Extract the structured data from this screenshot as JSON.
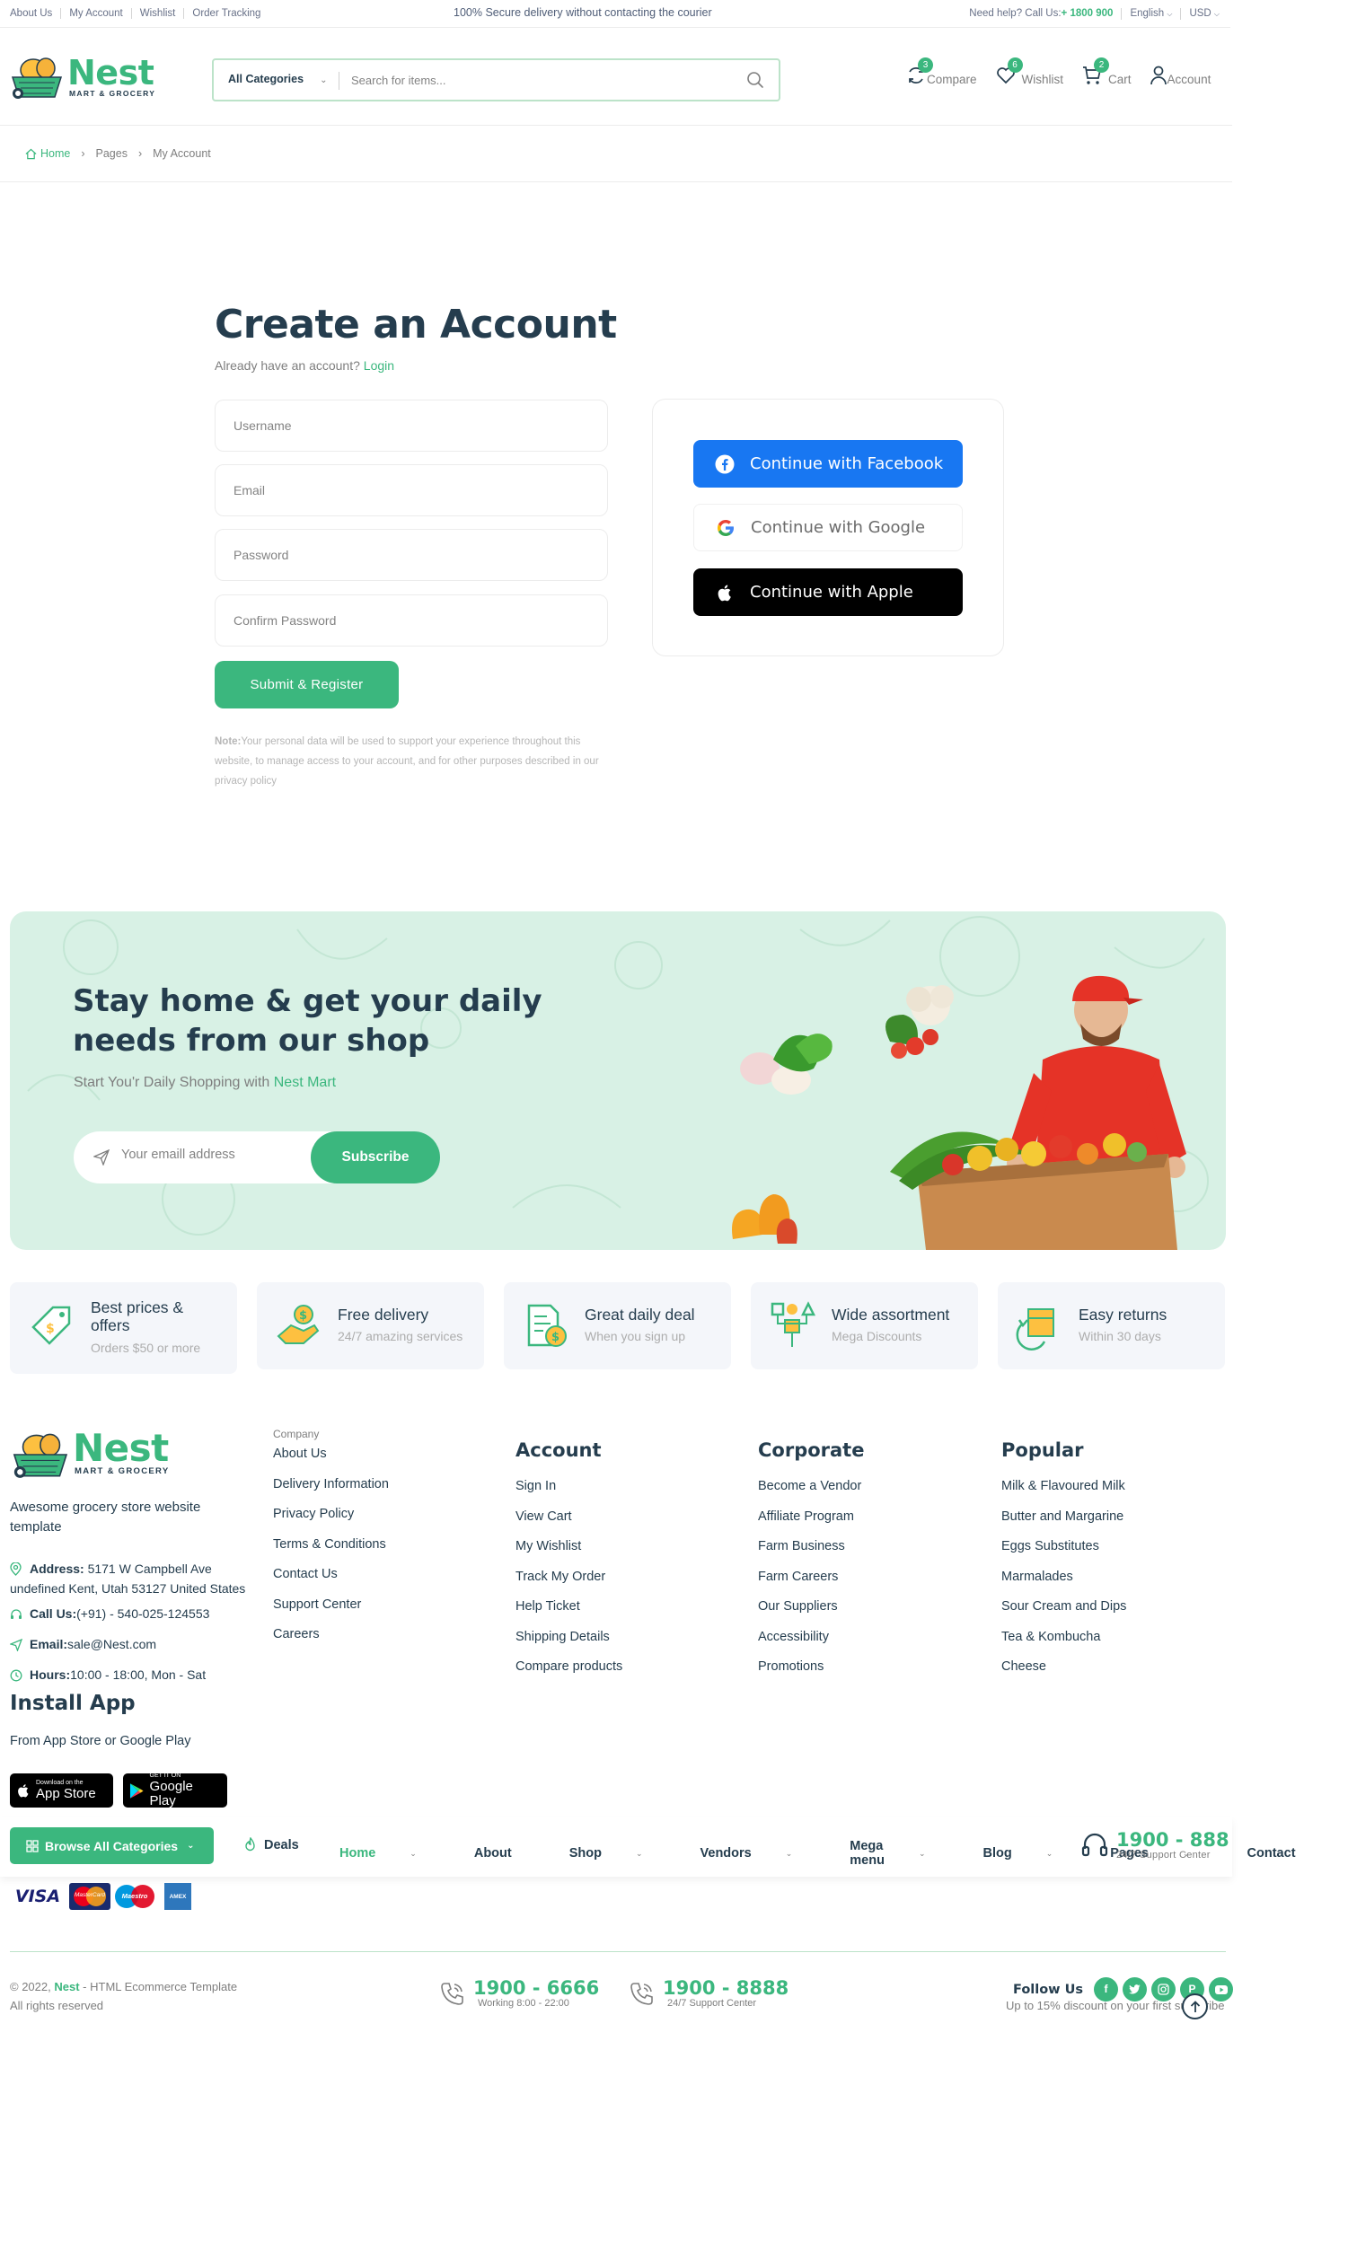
{
  "topbar": {
    "links": [
      "About Us",
      "My Account",
      "Wishlist",
      "Order Tracking"
    ],
    "notice": "100% Secure delivery without contacting the courier",
    "help_prefix": "Need help? Call Us:",
    "help_phone": "+ 1800 900",
    "language": "English",
    "currency": "USD"
  },
  "header": {
    "logo_name": "Nest",
    "logo_tagline": "MART & GROCERY",
    "search_category": "All Categories",
    "search_placeholder": "Search for items...",
    "icons": [
      {
        "label": "Compare",
        "count": "3"
      },
      {
        "label": "Wishlist",
        "count": "6"
      },
      {
        "label": "Cart",
        "count": "2"
      },
      {
        "label": "Account"
      }
    ]
  },
  "breadcrumb": [
    "Home",
    "Pages",
    "My Account"
  ],
  "register": {
    "title": "Create an Account",
    "have_account": "Already have an account?",
    "login_link": "Login",
    "placeholders": {
      "username": "Username",
      "email": "Email",
      "password": "Password",
      "confirm": "Confirm Password"
    },
    "submit": "Submit & Register",
    "note_label": "Note:",
    "note_text": "Your personal data will be used to support your experience throughout this website, to manage access to your account, and for other purposes described in our privacy policy",
    "social": {
      "facebook": "Continue with Facebook",
      "google": "Continue with Google",
      "apple": "Continue with Apple"
    }
  },
  "banner": {
    "title_line1": "Stay home & get your daily",
    "title_line2": "needs from our shop",
    "sub_prefix": "Start You'r Daily Shopping with",
    "sub_brand": "Nest Mart",
    "email_placeholder": "Your emaill address",
    "subscribe": "Subscribe"
  },
  "features": [
    {
      "title_line1": "Best prices &",
      "title_line2": "offers",
      "sub": "Orders $50 or more"
    },
    {
      "title": "Free delivery",
      "sub": "24/7 amazing services"
    },
    {
      "title": "Great daily deal",
      "sub": "When you sign up"
    },
    {
      "title": "Wide assortment",
      "sub": "Mega Discounts"
    },
    {
      "title": "Easy returns",
      "sub": "Within 30 days"
    }
  ],
  "footer": {
    "about": "Awesome grocery store website template",
    "address_label": "Address:",
    "address": "5171 W Campbell Ave undefined Kent, Utah 53127 United States",
    "call_label": "Call Us:",
    "call": "(+91) - 540-025-124553",
    "email_label": "Email:",
    "email": "sale@Nest.com",
    "hours_label": "Hours:",
    "hours": "10:00 - 18:00, Mon - Sat",
    "install_title": "Install App",
    "install_sub": "From App Store or Google Play",
    "appstore_small": "Download on the",
    "appstore_big": "App Store",
    "googleplay_small": "GET IT ON",
    "googleplay_big": "Google Play",
    "company": {
      "title": "Company",
      "items": [
        "About Us",
        "Delivery Information",
        "Privacy Policy",
        "Terms & Conditions",
        "Contact Us",
        "Support Center",
        "Careers"
      ]
    },
    "account": {
      "title": "Account",
      "items": [
        "Sign In",
        "View Cart",
        "My Wishlist",
        "Track My Order",
        "Help Ticket",
        "Shipping Details",
        "Compare products"
      ]
    },
    "corporate": {
      "title": "Corporate",
      "items": [
        "Become a Vendor",
        "Affiliate Program",
        "Farm Business",
        "Farm Careers",
        "Our Suppliers",
        "Accessibility",
        "Promotions"
      ]
    },
    "popular": {
      "title": "Popular",
      "items": [
        "Milk & Flavoured Milk",
        "Butter and Margarine",
        "Eggs Substitutes",
        "Marmalades",
        "Sour Cream and Dips",
        "Tea & Kombucha",
        "Cheese"
      ]
    }
  },
  "navbar": {
    "browse": "Browse All Categories",
    "deals": "Deals",
    "items": [
      {
        "label": "Home",
        "chev": true,
        "active": true
      },
      {
        "label": "About",
        "chev": false
      },
      {
        "label": "Shop",
        "chev": true
      },
      {
        "label": "Vendors",
        "chev": true
      },
      {
        "label": "Mega menu",
        "chev": true
      },
      {
        "label": "Blog",
        "chev": true
      },
      {
        "label": "Pages",
        "chev": true
      },
      {
        "label": "Contact",
        "chev": false
      }
    ],
    "phone": "1900 - 888",
    "phone_sub": "24/7 Support Center"
  },
  "payments": [
    "VISA",
    "MasterCard",
    "Maestro",
    "AMEX"
  ],
  "bottom": {
    "copyright_prefix": "© 2022,",
    "copyright_brand": "Nest",
    "copyright_suffix": "- HTML Ecommerce Template",
    "rights": "All rights reserved",
    "phone1": "1900 - 6666",
    "phone1_sub": "Working 8:00 - 22:00",
    "phone2": "1900 - 8888",
    "phone2_sub": "24/7 Support Center",
    "follow": "Follow Us",
    "discount": "Up to 15% discount on your first subscribe",
    "social_icons": [
      "facebook-icon",
      "twitter-icon",
      "instagram-icon",
      "pinterest-icon",
      "youtube-icon"
    ]
  },
  "colors": {
    "brand": "#3bb77e",
    "heading": "#253d4e",
    "muted": "#7e7e7e",
    "banner_bg": "#d8f1e5",
    "facebook": "#1877f2"
  }
}
